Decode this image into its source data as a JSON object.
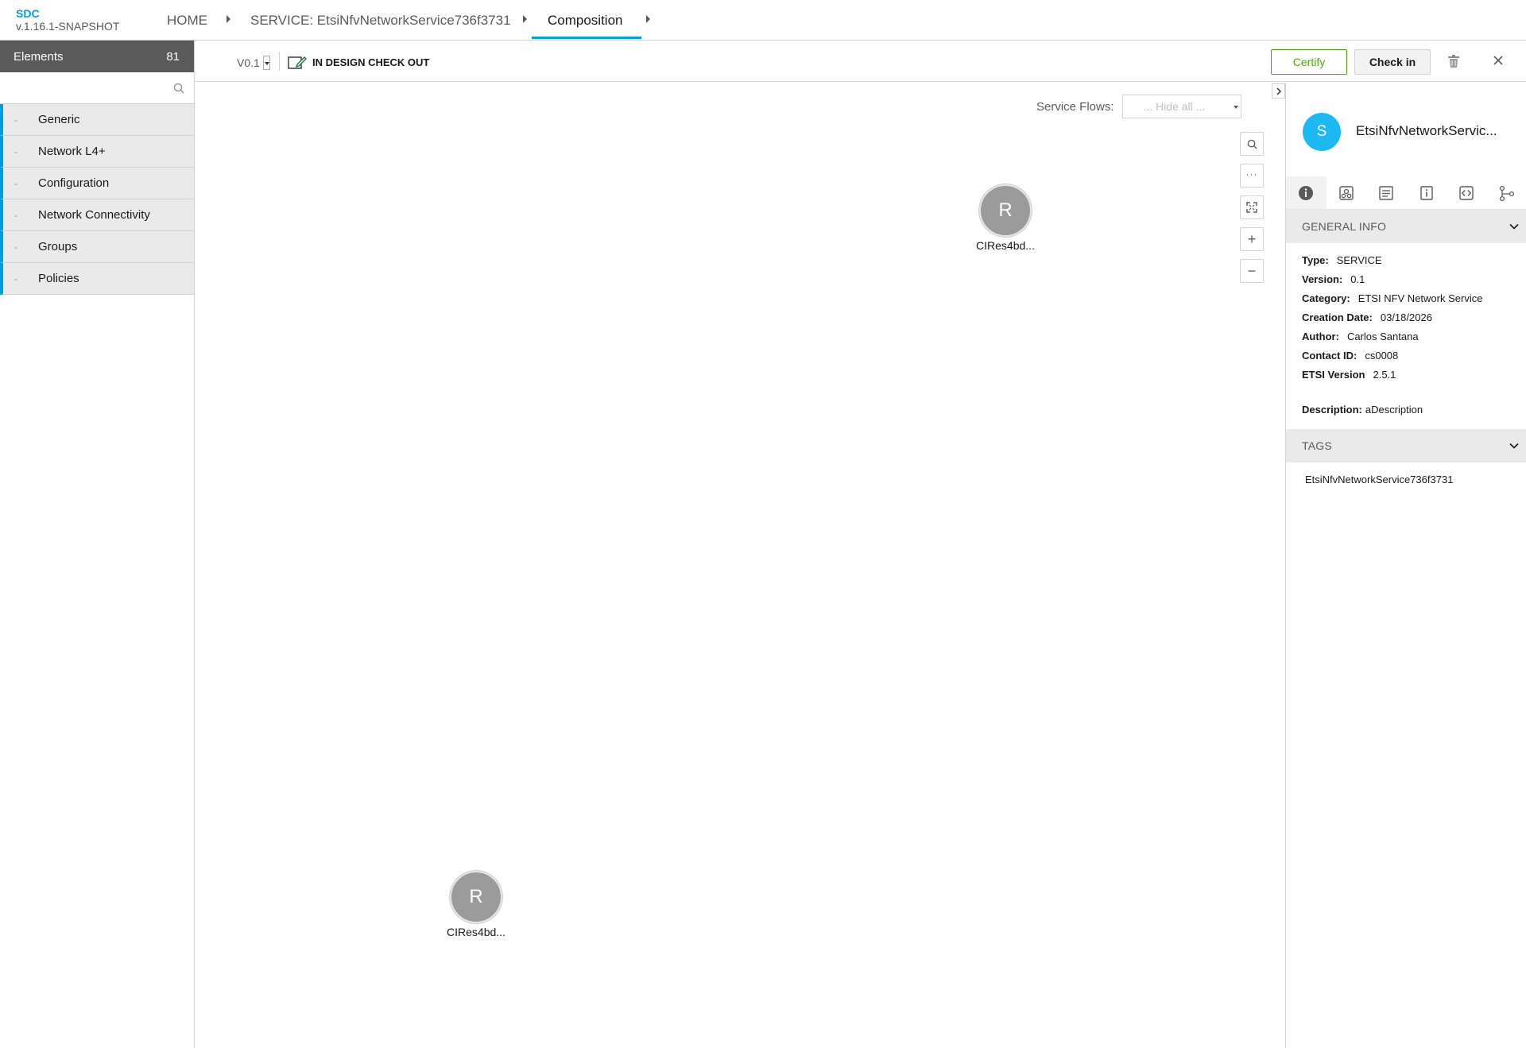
{
  "header": {
    "brand": "SDC",
    "version": "v.1.16.1-SNAPSHOT",
    "breadcrumbs": [
      {
        "label": "HOME"
      },
      {
        "label": "SERVICE: EtsiNfvNetworkService736f3731"
      },
      {
        "label": "Composition"
      }
    ]
  },
  "palette": {
    "title": "Elements",
    "count": "81",
    "search_placeholder": "",
    "items": [
      {
        "label": "Generic"
      },
      {
        "label": "Network L4+"
      },
      {
        "label": "Configuration"
      },
      {
        "label": "Network Connectivity"
      },
      {
        "label": "Groups"
      },
      {
        "label": "Policies"
      }
    ]
  },
  "toolbar": {
    "version": "V0.1",
    "status": "IN DESIGN CHECK OUT",
    "certify_label": "Certify",
    "checkin_label": "Check in"
  },
  "canvas": {
    "service_flows_label": "Service Flows:",
    "service_flows_value": "... Hide all ...",
    "nodes": [
      {
        "letter": "R",
        "label": "CIRes4bd..."
      },
      {
        "letter": "R",
        "label": "CIRes4bd..."
      }
    ]
  },
  "right_panel": {
    "avatar_letter": "S",
    "title": "EtsiNfvNetworkServic...",
    "general_info_title": "GENERAL INFO",
    "info": [
      {
        "key": "Type:",
        "value": "SERVICE"
      },
      {
        "key": "Version:",
        "value": "0.1"
      },
      {
        "key": "Category:",
        "value": "ETSI NFV Network Service"
      },
      {
        "key": "Creation Date:",
        "value": "03/18/2026"
      },
      {
        "key": "Author:",
        "value": "Carlos Santana"
      },
      {
        "key": "Contact ID:",
        "value": "cs0008"
      },
      {
        "key": "ETSI Version",
        "value": "2.5.1"
      }
    ],
    "description_key": "Description:",
    "description_value": "aDescription",
    "tags_title": "TAGS",
    "tags": [
      "EtsiNfvNetworkService736f3731"
    ]
  },
  "colors": {
    "accent": "#009fdb",
    "certify": "#4ca90c",
    "palette_header": "#5a5a5a",
    "node": "#9b9b9b",
    "avatar": "#1eb9f3"
  }
}
